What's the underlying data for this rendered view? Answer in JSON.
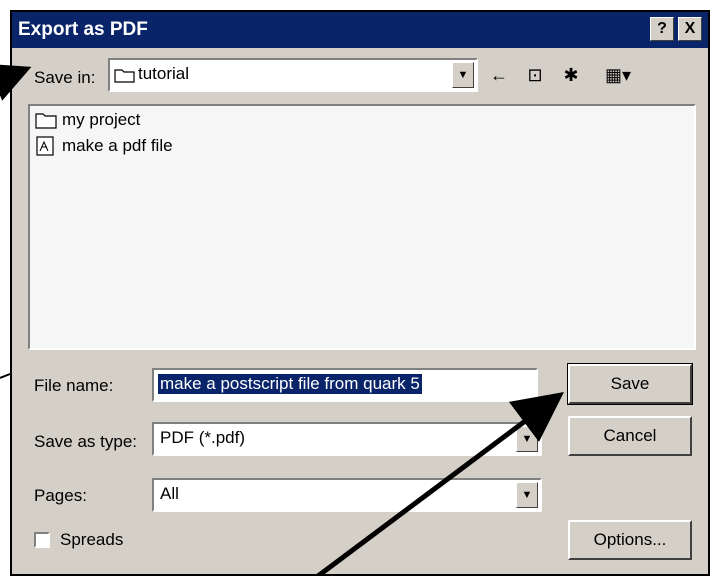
{
  "dialog": {
    "title": "Export as PDF",
    "help_button": "?",
    "close_button": "X"
  },
  "save_in": {
    "label": "Save in:",
    "value": "tutorial"
  },
  "toolbar": {
    "back_icon": "back-arrow-icon",
    "up_icon": "up-folder-icon",
    "new_folder_icon": "new-folder-icon",
    "view_icon": "view-menu-icon"
  },
  "files": [
    {
      "name": "my project",
      "icon": "folder-icon"
    },
    {
      "name": "make a pdf file",
      "icon": "pdf-file-icon"
    }
  ],
  "filename": {
    "label": "File name:",
    "value": "make a postscript file from quark 5"
  },
  "save_type": {
    "label": "Save as type:",
    "value": "PDF (*.pdf)"
  },
  "pages": {
    "label": "Pages:",
    "value": "All"
  },
  "spreads": {
    "label": "Spreads",
    "checked": false
  },
  "buttons": {
    "save": "Save",
    "cancel": "Cancel",
    "options": "Options..."
  }
}
